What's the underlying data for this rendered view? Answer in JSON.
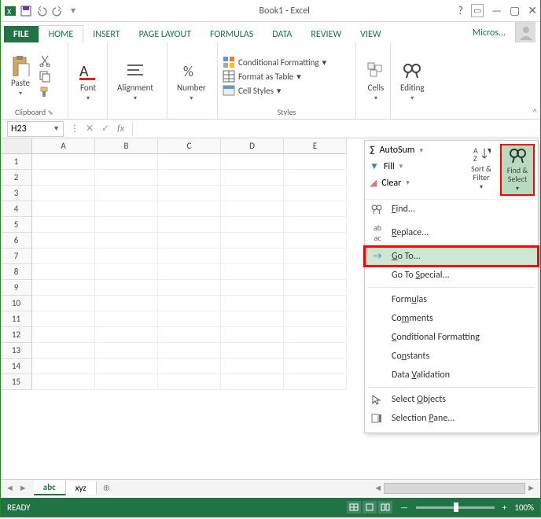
{
  "titlebar": {
    "title": "Book1 - Excel"
  },
  "tabs": {
    "file": "FILE",
    "home": "HOME",
    "insert": "INSERT",
    "page_layout": "PAGE LAYOUT",
    "formulas": "FORMULAS",
    "data": "DATA",
    "review": "REVIEW",
    "view": "VIEW",
    "micros": "Micros..."
  },
  "ribbon": {
    "clipboard": {
      "paste": "Paste",
      "label": "Clipboard"
    },
    "font": {
      "btn": "Font"
    },
    "alignment": {
      "btn": "Alignment"
    },
    "number": {
      "btn": "Number"
    },
    "styles": {
      "cf": "Conditional Formatting",
      "fat": "Format as Table",
      "cs": "Cell Styles",
      "label": "Styles"
    },
    "cells": {
      "btn": "Cells"
    },
    "editing": {
      "btn": "Editing"
    }
  },
  "namebox": {
    "value": "H23"
  },
  "columns": [
    "A",
    "B",
    "C",
    "D",
    "E"
  ],
  "rows": [
    "1",
    "2",
    "3",
    "4",
    "5",
    "6",
    "7",
    "8",
    "9",
    "10",
    "11",
    "12",
    "13",
    "14",
    "15"
  ],
  "dropdown": {
    "autosum": "AutoSum",
    "fill": "Fill",
    "clear": "Clear",
    "sortfilter": "Sort & Filter",
    "findselect": "Find & Select",
    "find": "Find...",
    "replace": "Replace...",
    "goto": "Go To...",
    "gotospecial": "Go To Special...",
    "formulas_item": "Formulas",
    "comments": "Comments",
    "condformat": "Conditional Formatting",
    "constants": "Constants",
    "datavalidation": "Data Validation",
    "selectobjects": "Select Objects",
    "selectionpane": "Selection Pane..."
  },
  "sheets": {
    "s1": "abc",
    "s2": "xyz"
  },
  "status": {
    "ready": "READY",
    "zoom": "100%"
  }
}
